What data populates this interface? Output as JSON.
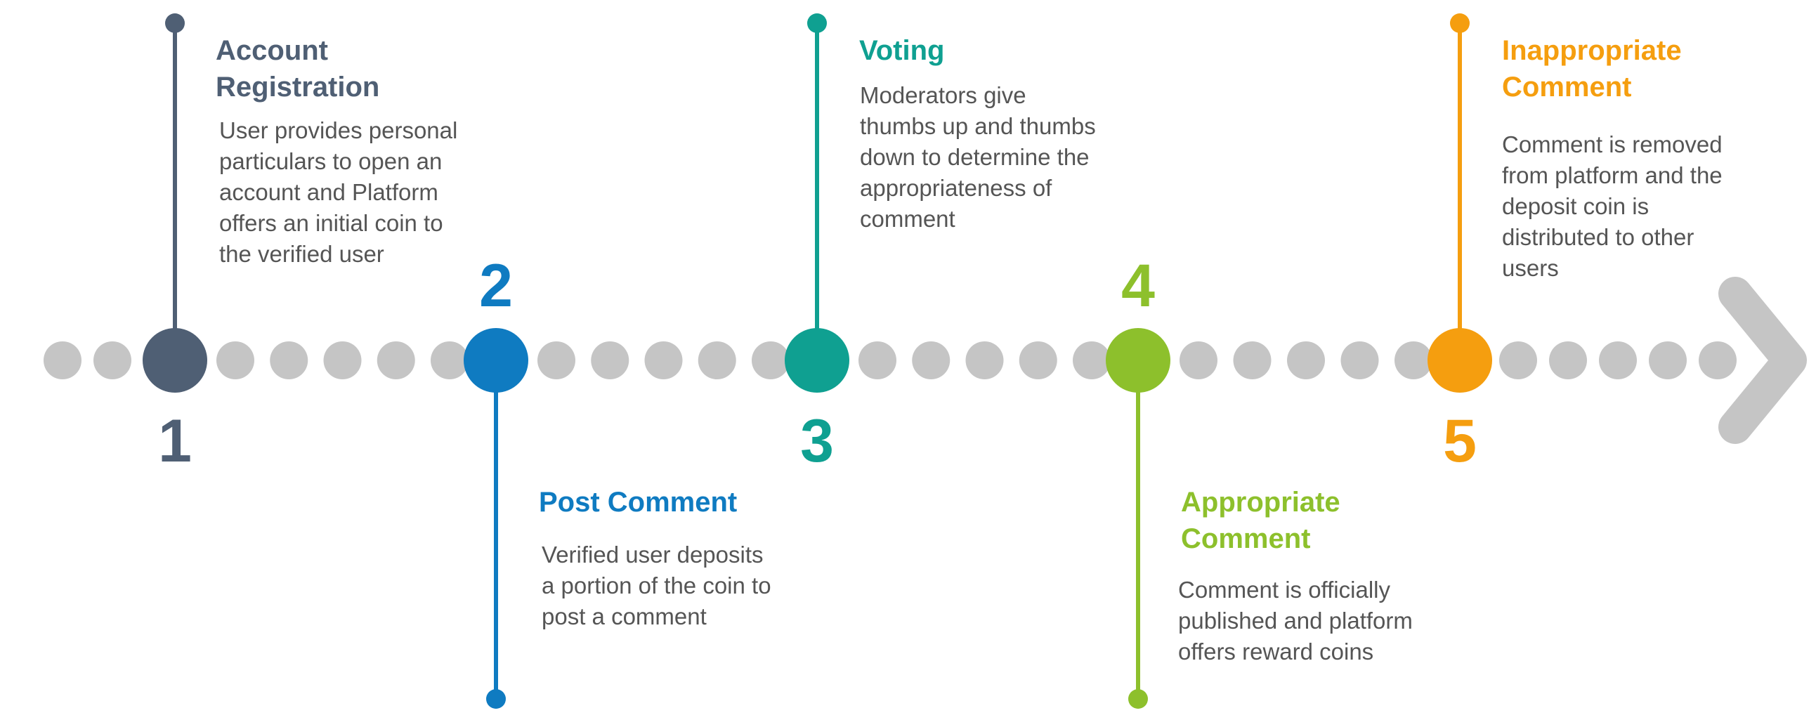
{
  "colors": {
    "track_dot": "#c5c5c5",
    "arrow": "#c5c5c5",
    "text": "#555555"
  },
  "steps": [
    {
      "number": "1",
      "title_lines": [
        "Account",
        "Registration"
      ],
      "description_lines": [
        "User provides personal",
        "particulars to open an",
        "account and Platform",
        "offers an initial coin to",
        "the verified user"
      ],
      "color": "#4f5f74",
      "position": "top"
    },
    {
      "number": "2",
      "title_lines": [
        "Post Comment"
      ],
      "description_lines": [
        "Verified user deposits",
        "a portion of the coin to",
        "post a comment"
      ],
      "color": "#0f7bc1",
      "position": "bottom"
    },
    {
      "number": "3",
      "title_lines": [
        "Voting"
      ],
      "description_lines": [
        "Moderators give",
        "thumbs up and thumbs",
        "down to determine the",
        "appropriateness of",
        "comment"
      ],
      "color": "#0fa091",
      "position": "top"
    },
    {
      "number": "4",
      "title_lines": [
        "Appropriate",
        "Comment"
      ],
      "description_lines": [
        "Comment is officially",
        "published and platform",
        "offers reward coins"
      ],
      "color": "#8dc02c",
      "position": "bottom"
    },
    {
      "number": "5",
      "title_lines": [
        "Inappropriate",
        "Comment"
      ],
      "description_lines": [
        "Comment is removed",
        "from platform and the",
        "deposit coin is",
        "distributed to other",
        "users"
      ],
      "color": "#f59e0f",
      "position": "top"
    }
  ]
}
